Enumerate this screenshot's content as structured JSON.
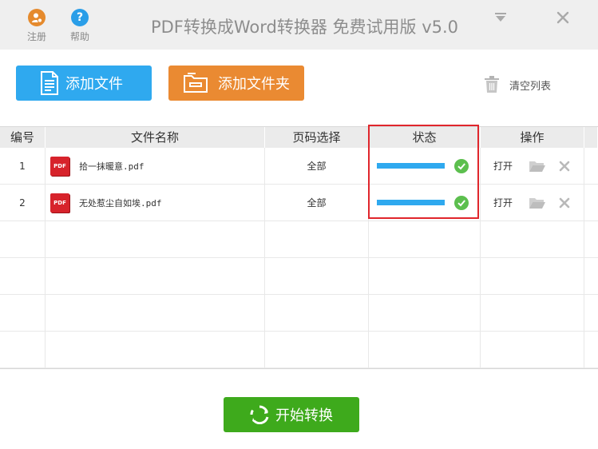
{
  "titlebar": {
    "register_label": "注册",
    "help_label": "帮助",
    "help_glyph": "?",
    "app_title": "PDF转换成Word转换器 免费试用版 v5.0"
  },
  "toolbar": {
    "add_file_label": "添加文件",
    "add_folder_label": "添加文件夹",
    "clear_list_label": "清空列表"
  },
  "table": {
    "headers": {
      "num": "编号",
      "name": "文件名称",
      "page": "页码选择",
      "status": "状态",
      "op": "操作"
    },
    "rows": [
      {
        "num": "1",
        "file_badge": "PDF",
        "file_name": "拾一抹暖意.pdf",
        "pages": "全部",
        "progress": 1.0,
        "status": "done",
        "open_label": "打开"
      },
      {
        "num": "2",
        "file_badge": "PDF",
        "file_name": "无处惹尘自如埃.pdf",
        "pages": "全部",
        "progress": 1.0,
        "status": "done",
        "open_label": "打开"
      }
    ],
    "empty_row_count": 4
  },
  "start_button": {
    "label": "开始转换"
  },
  "colors": {
    "blue": "#2fa9ef",
    "orange": "#ea8a32",
    "green": "#3eaa1c",
    "success": "#5cbf4e",
    "highlight": "#e0262c"
  }
}
